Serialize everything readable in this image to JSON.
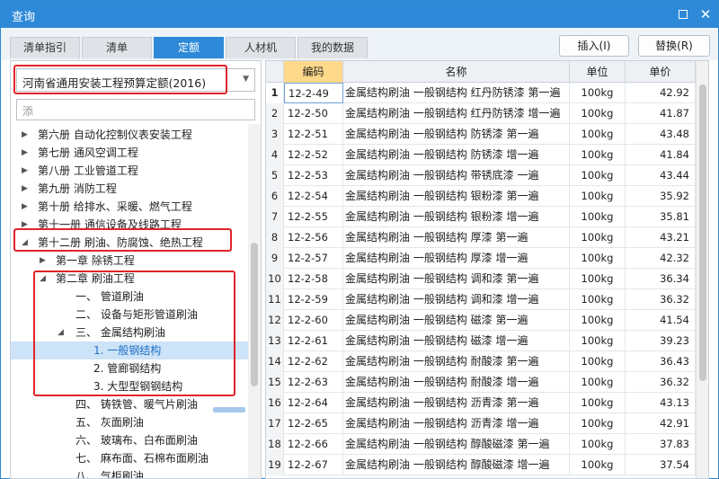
{
  "window": {
    "title": "查询"
  },
  "titlebar_icons": [
    "maximize-icon",
    "close-icon"
  ],
  "tabs": [
    {
      "label": "清单指引",
      "active": false
    },
    {
      "label": "清单",
      "active": false
    },
    {
      "label": "定额",
      "active": true
    },
    {
      "label": "人材机",
      "active": false
    },
    {
      "label": "我的数据",
      "active": false
    }
  ],
  "actions": {
    "insert_label": "插入(I)",
    "replace_label": "替换(R)"
  },
  "left": {
    "quota_select": "河南省通用安装工程预算定额(2016)",
    "search_placeholder": "添"
  },
  "tree": [
    {
      "label": "第六册 自动化控制仪表安装工程",
      "level": 0,
      "toggle": "collapsed"
    },
    {
      "label": "第七册 通风空调工程",
      "level": 0,
      "toggle": "collapsed"
    },
    {
      "label": "第八册 工业管道工程",
      "level": 0,
      "toggle": "collapsed"
    },
    {
      "label": "第九册 消防工程",
      "level": 0,
      "toggle": "collapsed"
    },
    {
      "label": "第十册 给排水、采暖、燃气工程",
      "level": 0,
      "toggle": "collapsed"
    },
    {
      "label": "第十一册 通信设备及线路工程",
      "level": 0,
      "toggle": "collapsed"
    },
    {
      "label": "第十二册 刷油、防腐蚀、绝热工程",
      "level": 0,
      "toggle": "expanded"
    },
    {
      "label": "第一章 除锈工程",
      "level": 1,
      "toggle": "collapsed"
    },
    {
      "label": "第二章 刷油工程",
      "level": 1,
      "toggle": "expanded"
    },
    {
      "label": "一、 管道刷油",
      "level": 2,
      "toggle": "none"
    },
    {
      "label": "二、 设备与矩形管道刷油",
      "level": 2,
      "toggle": "none"
    },
    {
      "label": "三、 金属结构刷油",
      "level": 2,
      "toggle": "expanded"
    },
    {
      "label": "1. 一般钢结构",
      "level": 3,
      "toggle": "none",
      "selected": true
    },
    {
      "label": "2. 管廊钢结构",
      "level": 3,
      "toggle": "none"
    },
    {
      "label": "3. 大型型钢钢结构",
      "level": 3,
      "toggle": "none"
    },
    {
      "label": "四、 铸铁管、暖气片刷油",
      "level": 2,
      "toggle": "none"
    },
    {
      "label": "五、 灰面刷油",
      "level": 2,
      "toggle": "none"
    },
    {
      "label": "六、 玻璃布、白布面刷油",
      "level": 2,
      "toggle": "none"
    },
    {
      "label": "七、 麻布面、石棉布面刷油",
      "level": 2,
      "toggle": "none"
    },
    {
      "label": "八、 气柜刷油",
      "level": 2,
      "toggle": "none"
    }
  ],
  "table": {
    "columns": [
      "编码",
      "名称",
      "单位",
      "单价"
    ],
    "rows": [
      {
        "idx": "1",
        "code": "12-2-49",
        "name": "金属结构刷油 一般钢结构 红丹防锈漆 第一遍",
        "unit": "100kg",
        "price": "42.92"
      },
      {
        "idx": "2",
        "code": "12-2-50",
        "name": "金属结构刷油 一般钢结构 红丹防锈漆 增一遍",
        "unit": "100kg",
        "price": "41.87"
      },
      {
        "idx": "3",
        "code": "12-2-51",
        "name": "金属结构刷油 一般钢结构 防锈漆 第一遍",
        "unit": "100kg",
        "price": "43.48"
      },
      {
        "idx": "4",
        "code": "12-2-52",
        "name": "金属结构刷油 一般钢结构 防锈漆 增一遍",
        "unit": "100kg",
        "price": "41.84"
      },
      {
        "idx": "5",
        "code": "12-2-53",
        "name": "金属结构刷油 一般钢结构 带锈底漆 一遍",
        "unit": "100kg",
        "price": "43.44"
      },
      {
        "idx": "6",
        "code": "12-2-54",
        "name": "金属结构刷油 一般钢结构 银粉漆 第一遍",
        "unit": "100kg",
        "price": "35.92"
      },
      {
        "idx": "7",
        "code": "12-2-55",
        "name": "金属结构刷油 一般钢结构 银粉漆 增一遍",
        "unit": "100kg",
        "price": "35.81"
      },
      {
        "idx": "8",
        "code": "12-2-56",
        "name": "金属结构刷油 一般钢结构 厚漆 第一遍",
        "unit": "100kg",
        "price": "43.21"
      },
      {
        "idx": "9",
        "code": "12-2-57",
        "name": "金属结构刷油 一般钢结构 厚漆 增一遍",
        "unit": "100kg",
        "price": "42.32"
      },
      {
        "idx": "10",
        "code": "12-2-58",
        "name": "金属结构刷油 一般钢结构 调和漆 第一遍",
        "unit": "100kg",
        "price": "36.34"
      },
      {
        "idx": "11",
        "code": "12-2-59",
        "name": "金属结构刷油 一般钢结构 调和漆 增一遍",
        "unit": "100kg",
        "price": "36.32"
      },
      {
        "idx": "12",
        "code": "12-2-60",
        "name": "金属结构刷油 一般钢结构 磁漆 第一遍",
        "unit": "100kg",
        "price": "41.54"
      },
      {
        "idx": "13",
        "code": "12-2-61",
        "name": "金属结构刷油 一般钢结构 磁漆 增一遍",
        "unit": "100kg",
        "price": "39.23"
      },
      {
        "idx": "14",
        "code": "12-2-62",
        "name": "金属结构刷油 一般钢结构 耐酸漆 第一遍",
        "unit": "100kg",
        "price": "36.43"
      },
      {
        "idx": "15",
        "code": "12-2-63",
        "name": "金属结构刷油 一般钢结构 耐酸漆 增一遍",
        "unit": "100kg",
        "price": "36.32"
      },
      {
        "idx": "16",
        "code": "12-2-64",
        "name": "金属结构刷油 一般钢结构 沥青漆 第一遍",
        "unit": "100kg",
        "price": "43.13"
      },
      {
        "idx": "17",
        "code": "12-2-65",
        "name": "金属结构刷油 一般钢结构 沥青漆 增一遍",
        "unit": "100kg",
        "price": "42.91"
      },
      {
        "idx": "18",
        "code": "12-2-66",
        "name": "金属结构刷油 一般钢结构 醇酸磁漆 第一遍",
        "unit": "100kg",
        "price": "37.83"
      },
      {
        "idx": "19",
        "code": "12-2-67",
        "name": "金属结构刷油 一般钢结构 醇酸磁漆 增一遍",
        "unit": "100kg",
        "price": "37.54"
      }
    ]
  },
  "colors": {
    "accent": "#2e8ad8",
    "highlight": "#e0242a",
    "selected_row": "#cde3f7",
    "code_header": "#ffd98a"
  }
}
